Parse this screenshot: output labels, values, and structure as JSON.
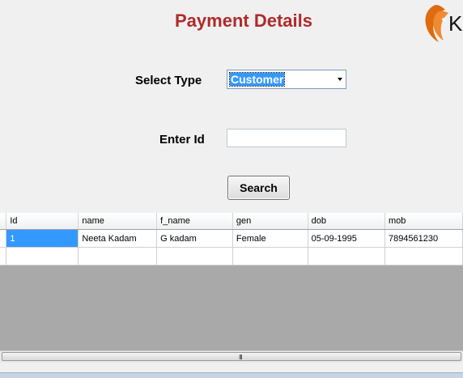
{
  "page": {
    "title": "Payment Details"
  },
  "logo": {
    "letter": "K",
    "accent": "#e06a10"
  },
  "form": {
    "select_type_label": "Select Type",
    "select_type_value": "Customer",
    "enter_id_label": "Enter Id",
    "enter_id_value": "",
    "search_label": "Search"
  },
  "grid": {
    "columns": [
      "Id",
      "name",
      "f_name",
      "gen",
      "dob",
      "mob"
    ],
    "rows": [
      [
        "1",
        "Neeta Kadam",
        "G kadam",
        "Female",
        "05-09-1995",
        "7894561230"
      ]
    ]
  },
  "scrollbar": {
    "grip": "III"
  },
  "colors": {
    "title": "#b02a2a",
    "selection": "#3399ff",
    "grid_bg": "#a9a9a9"
  }
}
